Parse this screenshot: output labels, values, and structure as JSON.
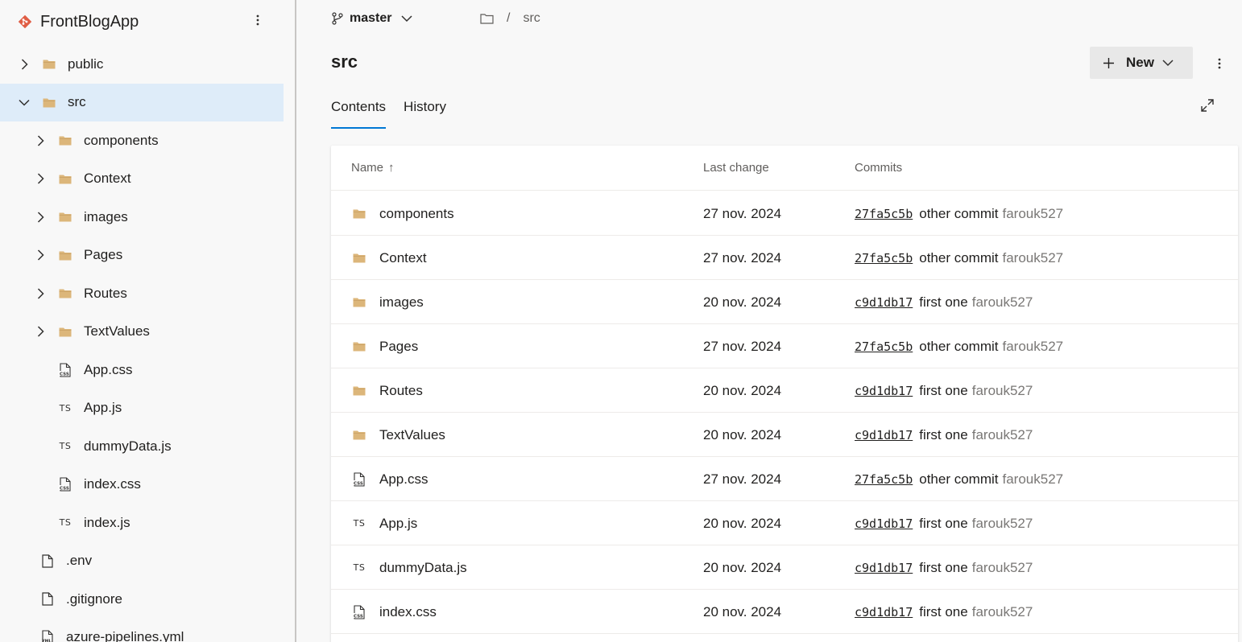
{
  "repo": {
    "name": "FrontBlogApp"
  },
  "tree": [
    {
      "label": "public",
      "type": "folder",
      "expander": "collapsed",
      "level": 0,
      "selected": false
    },
    {
      "label": "src",
      "type": "folder",
      "expander": "expanded",
      "level": 0,
      "selected": true
    },
    {
      "label": "components",
      "type": "folder",
      "expander": "collapsed",
      "level": 1,
      "selected": false
    },
    {
      "label": "Context",
      "type": "folder",
      "expander": "collapsed",
      "level": 1,
      "selected": false
    },
    {
      "label": "images",
      "type": "folder",
      "expander": "collapsed",
      "level": 1,
      "selected": false
    },
    {
      "label": "Pages",
      "type": "folder",
      "expander": "collapsed",
      "level": 1,
      "selected": false
    },
    {
      "label": "Routes",
      "type": "folder",
      "expander": "collapsed",
      "level": 1,
      "selected": false
    },
    {
      "label": "TextValues",
      "type": "folder",
      "expander": "collapsed",
      "level": 1,
      "selected": false
    },
    {
      "label": "App.css",
      "type": "css",
      "expander": "none",
      "level": 1,
      "selected": false
    },
    {
      "label": "App.js",
      "type": "ts",
      "expander": "none",
      "level": 1,
      "selected": false
    },
    {
      "label": "dummyData.js",
      "type": "ts",
      "expander": "none",
      "level": 1,
      "selected": false
    },
    {
      "label": "index.css",
      "type": "css",
      "expander": "none",
      "level": 1,
      "selected": false
    },
    {
      "label": "index.js",
      "type": "ts",
      "expander": "none",
      "level": 1,
      "selected": false
    },
    {
      "label": ".env",
      "type": "file",
      "expander": "none",
      "level": 0,
      "selected": false
    },
    {
      "label": ".gitignore",
      "type": "file",
      "expander": "none",
      "level": 0,
      "selected": false
    },
    {
      "label": "azure-pipelines.yml",
      "type": "yml",
      "expander": "none",
      "level": 0,
      "selected": false
    }
  ],
  "branch": {
    "name": "master"
  },
  "breadcrumb": {
    "separator": "/",
    "current": "src"
  },
  "page": {
    "title": "src"
  },
  "toolbar": {
    "new_label": "New"
  },
  "tabs": [
    {
      "label": "Contents",
      "active": true
    },
    {
      "label": "History",
      "active": false
    }
  ],
  "table": {
    "headers": {
      "name": "Name",
      "sort_indicator": "↑",
      "last_change": "Last change",
      "commits": "Commits"
    },
    "rows": [
      {
        "name": "components",
        "type": "folder",
        "date": "27 nov. 2024",
        "hash": "27fa5c5b",
        "message": "other commit",
        "author": "farouk527"
      },
      {
        "name": "Context",
        "type": "folder",
        "date": "27 nov. 2024",
        "hash": "27fa5c5b",
        "message": "other commit",
        "author": "farouk527"
      },
      {
        "name": "images",
        "type": "folder",
        "date": "20 nov. 2024",
        "hash": "c9d1db17",
        "message": "first one",
        "author": "farouk527"
      },
      {
        "name": "Pages",
        "type": "folder",
        "date": "27 nov. 2024",
        "hash": "27fa5c5b",
        "message": "other commit",
        "author": "farouk527"
      },
      {
        "name": "Routes",
        "type": "folder",
        "date": "20 nov. 2024",
        "hash": "c9d1db17",
        "message": "first one",
        "author": "farouk527"
      },
      {
        "name": "TextValues",
        "type": "folder",
        "date": "20 nov. 2024",
        "hash": "c9d1db17",
        "message": "first one",
        "author": "farouk527"
      },
      {
        "name": "App.css",
        "type": "css",
        "date": "27 nov. 2024",
        "hash": "27fa5c5b",
        "message": "other commit",
        "author": "farouk527"
      },
      {
        "name": "App.js",
        "type": "ts",
        "date": "20 nov. 2024",
        "hash": "c9d1db17",
        "message": "first one",
        "author": "farouk527"
      },
      {
        "name": "dummyData.js",
        "type": "ts",
        "date": "20 nov. 2024",
        "hash": "c9d1db17",
        "message": "first one",
        "author": "farouk527"
      },
      {
        "name": "index.css",
        "type": "css",
        "date": "20 nov. 2024",
        "hash": "c9d1db17",
        "message": "first one",
        "author": "farouk527"
      }
    ]
  },
  "icons": {
    "folder_color": "#dcb67a",
    "repo_logo_color": "#e05d44",
    "accent": "#0078d4",
    "ts_badge": "TS"
  }
}
